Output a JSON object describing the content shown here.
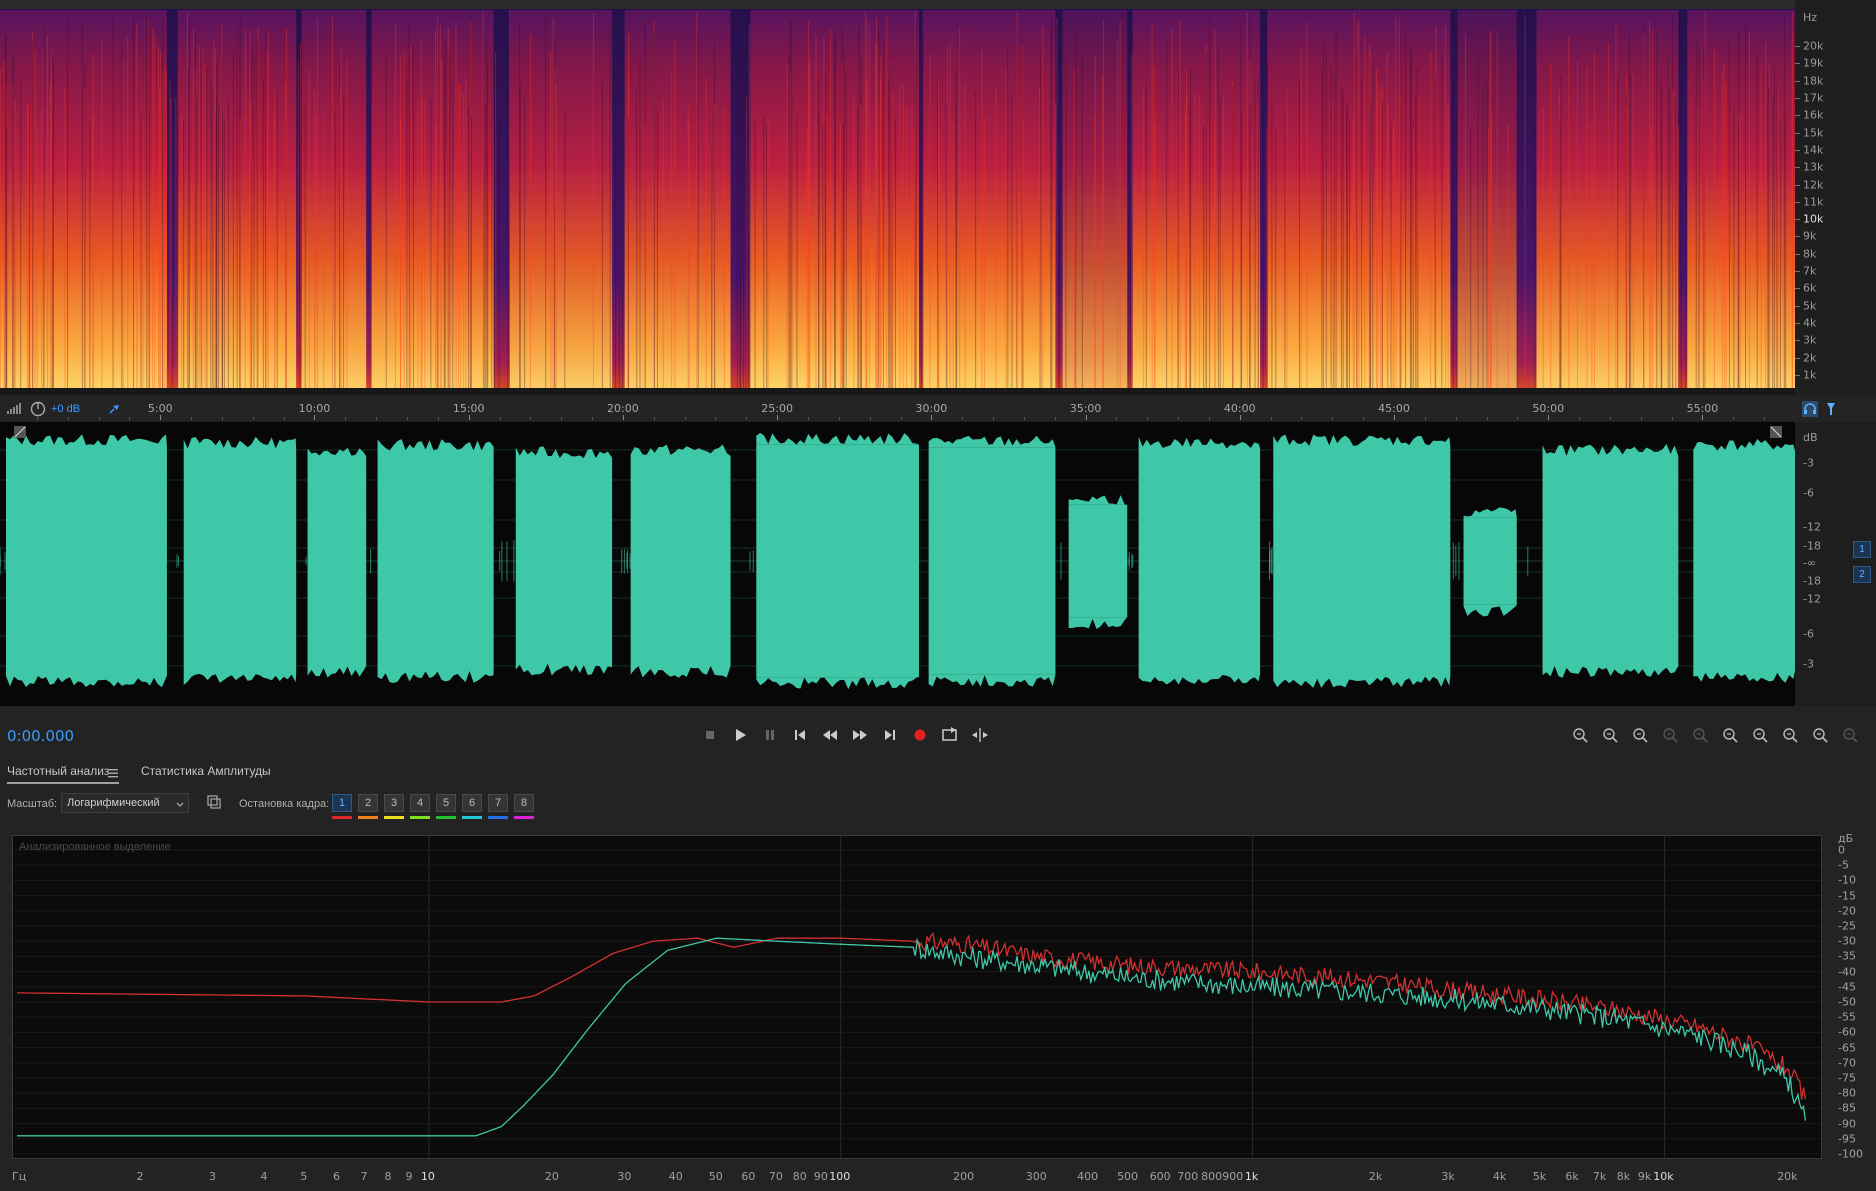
{
  "spectrogram": {
    "unit": "Hz",
    "freq_labels": [
      "20k",
      "19k",
      "18k",
      "17k",
      "16k",
      "15k",
      "14k",
      "13k",
      "12k",
      "11k",
      "10k",
      "9k",
      "8k",
      "7k",
      "6k",
      "5k",
      "4k",
      "3k",
      "2k",
      "1k"
    ]
  },
  "timeline": {
    "level_display": "+0 dB",
    "time_labels": [
      "5:00",
      "10:00",
      "15:00",
      "20:00",
      "25:00",
      "30:00",
      "35:00",
      "40:00",
      "45:00",
      "50:00",
      "55:00"
    ]
  },
  "waveform": {
    "unit": "dB",
    "db_labels_top": [
      "-3",
      "-6",
      "-12",
      "-18",
      "-∞"
    ],
    "db_labels_bottom": [
      "-18",
      "-12",
      "-6",
      "-3"
    ],
    "channel_1": "1",
    "channel_2": "2",
    "color": "#3ec8a8",
    "segments": [
      {
        "s": 0.0,
        "e": 0.093,
        "lvl": 0.92
      },
      {
        "s": 0.099,
        "e": 0.165,
        "lvl": 0.9
      },
      {
        "s": 0.168,
        "e": 0.204,
        "lvl": 0.84
      },
      {
        "s": 0.207,
        "e": 0.275,
        "lvl": 0.88
      },
      {
        "s": 0.284,
        "e": 0.341,
        "lvl": 0.82
      },
      {
        "s": 0.348,
        "e": 0.407,
        "lvl": 0.84
      },
      {
        "s": 0.418,
        "e": 0.512,
        "lvl": 0.93
      },
      {
        "s": 0.514,
        "e": 0.588,
        "lvl": 0.91
      },
      {
        "s": 0.592,
        "e": 0.628,
        "lvl": 0.45
      },
      {
        "s": 0.631,
        "e": 0.702,
        "lvl": 0.9
      },
      {
        "s": 0.706,
        "e": 0.808,
        "lvl": 0.92
      },
      {
        "s": 0.812,
        "e": 0.845,
        "lvl": 0.35
      },
      {
        "s": 0.856,
        "e": 0.935,
        "lvl": 0.84
      },
      {
        "s": 0.94,
        "e": 1.0,
        "lvl": 0.88
      }
    ]
  },
  "transport": {
    "time": "0:00.000",
    "record_color": "#e02020"
  },
  "analysis": {
    "tab_active": "Частотный анализ",
    "tab_other": "Статистика Амплитуды",
    "scale_label": "Масштаб:",
    "scale_value": "Логарифмический",
    "freeze_label": "Остановка кадра:",
    "freeze_slots": [
      "1",
      "2",
      "3",
      "4",
      "5",
      "6",
      "7",
      "8"
    ],
    "freeze_colors": [
      "#e02828",
      "#f08020",
      "#e8e020",
      "#80e020",
      "#20c030",
      "#20c8d8",
      "#2070e8",
      "#e020d8"
    ],
    "graph_title": "Анализированное выделение",
    "y_unit": "дБ",
    "y_labels": [
      "0",
      "-5",
      "-10",
      "-15",
      "-20",
      "-25",
      "-30",
      "-35",
      "-40",
      "-45",
      "-50",
      "-55",
      "-60",
      "-65",
      "-70",
      "-75",
      "-80",
      "-85",
      "-90",
      "-95",
      "-100"
    ],
    "x_unit": "Гц",
    "x_labels": [
      "2",
      "3",
      "4",
      "5",
      "6",
      "7",
      "8",
      "9",
      "10",
      "20",
      "30",
      "40",
      "50",
      "60",
      "70",
      "80",
      "90",
      "100",
      "200",
      "300",
      "400",
      "500",
      "600",
      "700",
      "800",
      "900",
      "1k",
      "2k",
      "3k",
      "4k",
      "5k",
      "6k",
      "7k",
      "8k",
      "9k",
      "10k",
      "20k"
    ],
    "x_values": [
      2,
      3,
      4,
      5,
      6,
      7,
      8,
      9,
      10,
      20,
      30,
      40,
      50,
      60,
      70,
      80,
      90,
      100,
      200,
      300,
      400,
      500,
      600,
      700,
      800,
      900,
      1000,
      2000,
      3000,
      4000,
      5000,
      6000,
      7000,
      8000,
      9000,
      10000,
      20000
    ]
  },
  "chart_data": {
    "type": "line",
    "xlabel": "Гц",
    "ylabel": "дБ",
    "xscale": "log",
    "xlim": [
      1,
      24000
    ],
    "ylim": [
      -100,
      0
    ],
    "series": [
      {
        "color": "#d43030",
        "points": [
          [
            1,
            -47
          ],
          [
            5,
            -48
          ],
          [
            10,
            -50
          ],
          [
            15,
            -50
          ],
          [
            18,
            -48
          ],
          [
            22,
            -42
          ],
          [
            28,
            -34
          ],
          [
            35,
            -30
          ],
          [
            45,
            -29
          ],
          [
            55,
            -32
          ],
          [
            70,
            -29
          ],
          [
            100,
            -29
          ],
          [
            150,
            -30
          ],
          [
            200,
            -31
          ],
          [
            300,
            -35
          ],
          [
            500,
            -38
          ],
          [
            1000,
            -40
          ],
          [
            2000,
            -43
          ],
          [
            3000,
            -46
          ],
          [
            5000,
            -49
          ],
          [
            8000,
            -53
          ],
          [
            12000,
            -58
          ],
          [
            16000,
            -64
          ],
          [
            20000,
            -72
          ],
          [
            22000,
            -82
          ]
        ]
      },
      {
        "color": "#3ec8a8",
        "points": [
          [
            1,
            -94
          ],
          [
            10,
            -94
          ],
          [
            13,
            -94
          ],
          [
            15,
            -91
          ],
          [
            17,
            -84
          ],
          [
            20,
            -74
          ],
          [
            24,
            -60
          ],
          [
            30,
            -44
          ],
          [
            38,
            -33
          ],
          [
            50,
            -29
          ],
          [
            70,
            -30
          ],
          [
            100,
            -31
          ],
          [
            150,
            -32
          ],
          [
            200,
            -35
          ],
          [
            300,
            -38
          ],
          [
            500,
            -42
          ],
          [
            1000,
            -45
          ],
          [
            2000,
            -47
          ],
          [
            3000,
            -49
          ],
          [
            5000,
            -52
          ],
          [
            8000,
            -56
          ],
          [
            12000,
            -61
          ],
          [
            16000,
            -67
          ],
          [
            20000,
            -76
          ],
          [
            22000,
            -89
          ]
        ]
      }
    ]
  }
}
